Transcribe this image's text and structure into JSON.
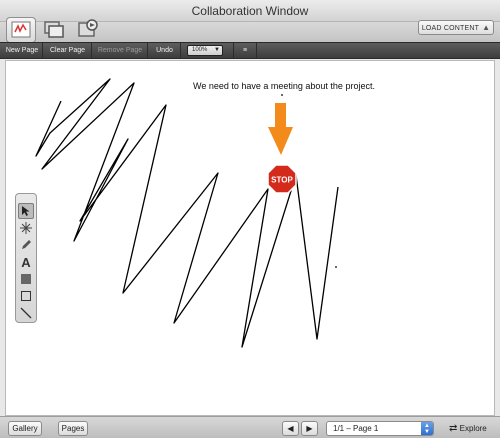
{
  "window": {
    "title": "Collaboration Window"
  },
  "toolbar": {
    "modes": [
      {
        "icon": "whiteboard-icon",
        "active": true
      },
      {
        "icon": "screen-share-icon",
        "active": false
      },
      {
        "icon": "media-icon",
        "active": false
      }
    ],
    "load_content_label": "LOAD CONTENT"
  },
  "pagebar": {
    "new_page": "New Page",
    "clear_page": "Clear Page",
    "remove_page": "Remove Page",
    "undo": "Undo",
    "zoom": "100%"
  },
  "canvas": {
    "text_note": "We need to have a meeting about the project.",
    "stop_sign_label": "STOP",
    "arrow_color": "#f28a1c",
    "stop_color": "#d42a1c"
  },
  "palette": {
    "tools": [
      "select-arrow-icon",
      "laser-pointer-icon",
      "pencil-icon",
      "text-icon",
      "shape-fill-icon",
      "rectangle-icon",
      "line-icon"
    ],
    "text_glyph": "A"
  },
  "statusbar": {
    "gallery": "Gallery",
    "pages": "Pages",
    "page_select": "1/1 – Page 1",
    "explore": "Explore"
  }
}
